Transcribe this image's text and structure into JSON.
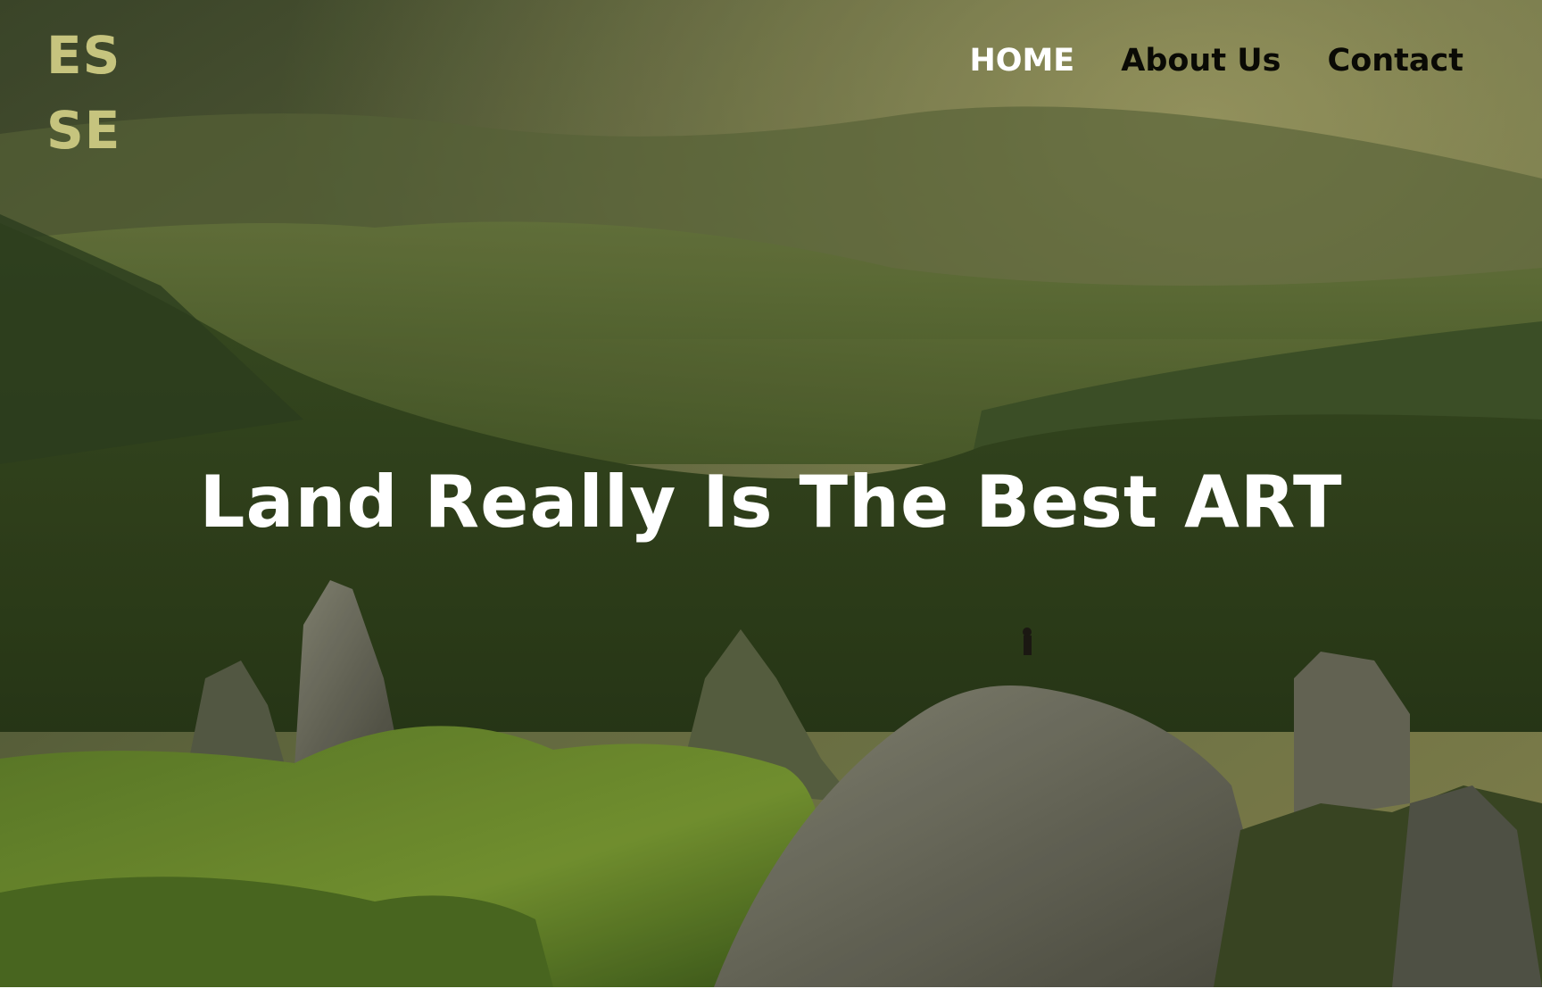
{
  "brand": {
    "logo_line1": "ES",
    "logo_line2": "SE",
    "logo_color": "#c6c47e"
  },
  "nav": {
    "items": [
      {
        "label": "HOME",
        "active": true
      },
      {
        "label": "About Us",
        "active": false
      },
      {
        "label": "Contact",
        "active": false
      }
    ]
  },
  "hero": {
    "headline": "Land Really Is The Best ART",
    "background_image": "mountain-landscape-photo"
  },
  "colors": {
    "active_nav": "#ffffff",
    "inactive_nav": "#0a0a05",
    "headline": "#ffffff"
  }
}
